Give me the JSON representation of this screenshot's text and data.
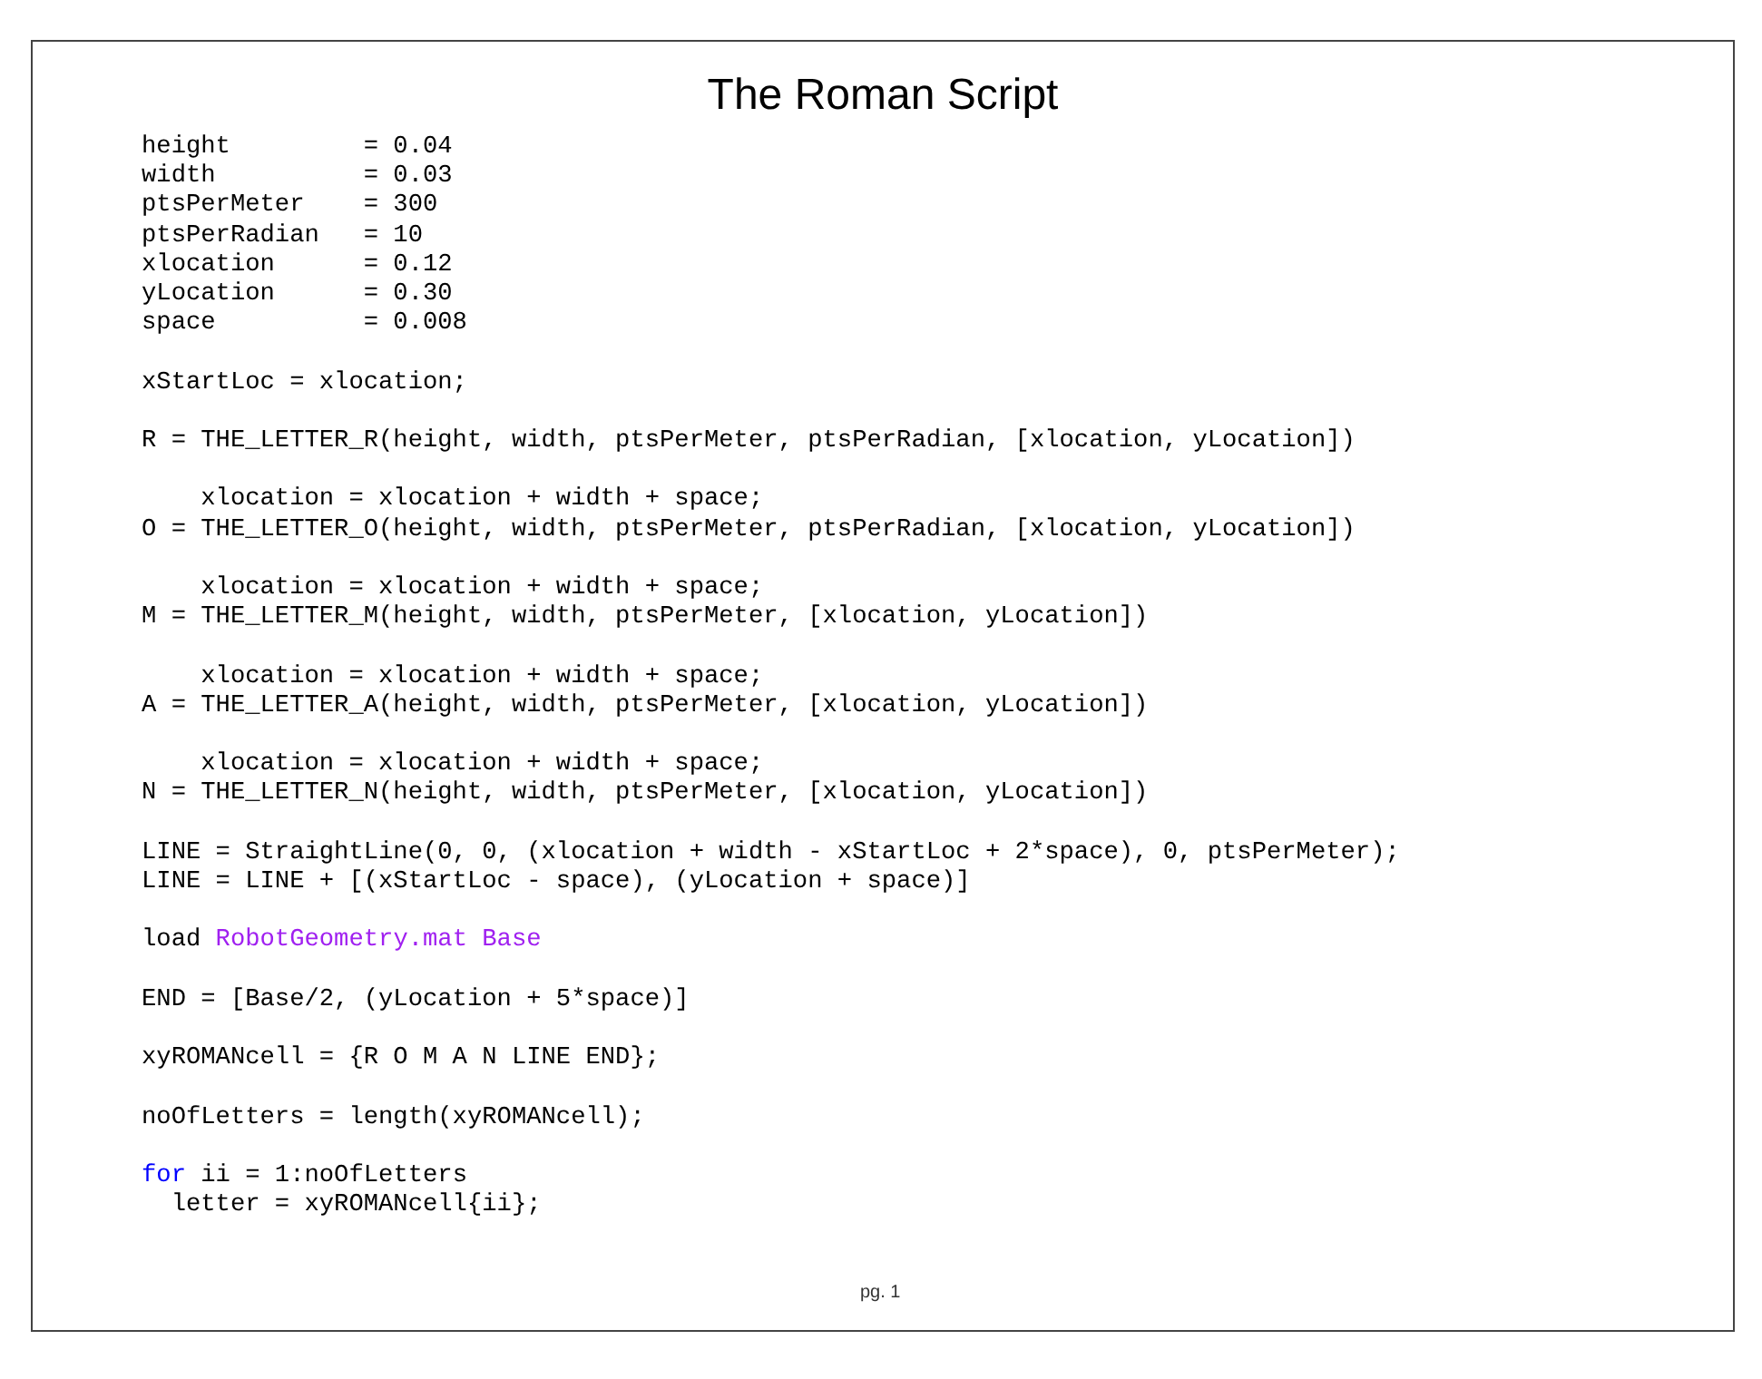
{
  "title": "The Roman Script",
  "code_blocks": [
    [
      [
        {
          "kind": "plain",
          "text": "height         = 0.04"
        }
      ],
      [
        {
          "kind": "plain",
          "text": "width          = 0.03"
        }
      ],
      [
        {
          "kind": "plain",
          "text": "ptsPerMeter    = 300"
        }
      ],
      [
        {
          "kind": "plain",
          "text": "ptsPerRadian   = 10"
        }
      ],
      [
        {
          "kind": "plain",
          "text": "xlocation      = 0.12"
        }
      ],
      [
        {
          "kind": "plain",
          "text": "yLocation      = 0.30"
        }
      ],
      [
        {
          "kind": "plain",
          "text": "space          = 0.008"
        }
      ]
    ],
    [
      [
        {
          "kind": "plain",
          "text": "xStartLoc = xlocation;"
        }
      ]
    ],
    [
      [
        {
          "kind": "plain",
          "text": "R = THE_LETTER_R(height, width, ptsPerMeter, ptsPerRadian, [xlocation, yLocation])"
        }
      ]
    ],
    [
      [
        {
          "kind": "plain",
          "text": "    xlocation = xlocation + width + space;"
        }
      ],
      [
        {
          "kind": "plain",
          "text": "O = THE_LETTER_O(height, width, ptsPerMeter, ptsPerRadian, [xlocation, yLocation])"
        }
      ]
    ],
    [
      [
        {
          "kind": "plain",
          "text": "    xlocation = xlocation + width + space;"
        }
      ],
      [
        {
          "kind": "plain",
          "text": "M = THE_LETTER_M(height, width, ptsPerMeter, [xlocation, yLocation])"
        }
      ]
    ],
    [
      [
        {
          "kind": "plain",
          "text": "    xlocation = xlocation + width + space;"
        }
      ],
      [
        {
          "kind": "plain",
          "text": "A = THE_LETTER_A(height, width, ptsPerMeter, [xlocation, yLocation])"
        }
      ]
    ],
    [
      [
        {
          "kind": "plain",
          "text": "    xlocation = xlocation + width + space;"
        }
      ],
      [
        {
          "kind": "plain",
          "text": "N = THE_LETTER_N(height, width, ptsPerMeter, [xlocation, yLocation])"
        }
      ]
    ],
    [
      [
        {
          "kind": "plain",
          "text": "LINE = StraightLine(0, 0, (xlocation + width - xStartLoc + 2*space), 0, ptsPerMeter);"
        }
      ],
      [
        {
          "kind": "plain",
          "text": "LINE = LINE + [(xStartLoc - space), (yLocation + space)]"
        }
      ]
    ],
    [
      [
        {
          "kind": "plain",
          "text": "load "
        },
        {
          "kind": "string",
          "text": "RobotGeometry.mat Base"
        }
      ]
    ],
    [
      [
        {
          "kind": "plain",
          "text": "END = [Base/2, (yLocation + 5*space)]"
        }
      ]
    ],
    [
      [
        {
          "kind": "plain",
          "text": "xyROMANcell = {R O M A N LINE END};"
        }
      ]
    ],
    [
      [
        {
          "kind": "plain",
          "text": "noOfLetters = length(xyROMANcell);"
        }
      ]
    ],
    [
      [
        {
          "kind": "keyword",
          "text": "for"
        },
        {
          "kind": "plain",
          "text": " ii = 1:noOfLetters"
        }
      ],
      [
        {
          "kind": "plain",
          "text": "  letter = xyROMANcell{ii};"
        }
      ]
    ]
  ],
  "page_number": "pg. 1"
}
